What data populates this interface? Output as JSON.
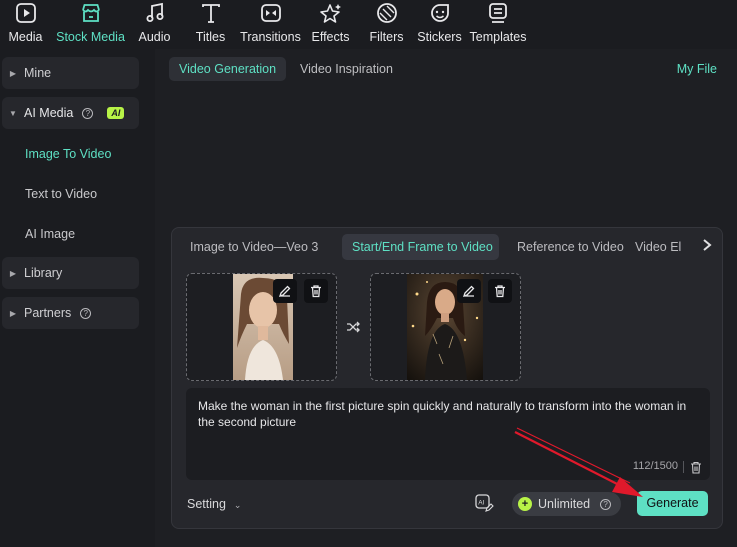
{
  "toolbar": {
    "items": [
      {
        "label": "Media",
        "icon": "media-icon"
      },
      {
        "label": "Stock Media",
        "icon": "stock-media-icon",
        "active": true
      },
      {
        "label": "Audio",
        "icon": "music-note-icon"
      },
      {
        "label": "Titles",
        "icon": "text-t-icon"
      },
      {
        "label": "Transitions",
        "icon": "transitions-icon"
      },
      {
        "label": "Effects",
        "icon": "effects-sparkle-icon"
      },
      {
        "label": "Filters",
        "icon": "filters-icon"
      },
      {
        "label": "Stickers",
        "icon": "stickers-icon"
      },
      {
        "label": "Templates",
        "icon": "templates-icon"
      }
    ]
  },
  "sidebar": {
    "mine": "Mine",
    "ai_media": "AI Media",
    "ai_badge": "AI",
    "image_to_video": "Image To Video",
    "text_to_video": "Text to Video",
    "ai_image": "AI Image",
    "library": "Library",
    "partners": "Partners"
  },
  "main": {
    "tab_video_generation": "Video Generation",
    "tab_video_inspiration": "Video Inspiration",
    "my_file": "My File"
  },
  "panel": {
    "subtabs": [
      "Image to Video—Veo 3",
      "Start/End Frame to Video",
      "Reference to Video",
      "Video El"
    ],
    "active_subtab": "Start/End Frame to Video",
    "prompt_text": "Make the woman in the first picture spin quickly and naturally to transform into the woman in the second picture",
    "char_count": "112/1500",
    "setting_label": "Setting",
    "unlimited_label": "Unlimited",
    "generate_label": "Generate"
  },
  "colors": {
    "accent": "#5ee0c4",
    "badge": "#b8f347",
    "background": "#1b1c20",
    "panel": "#26272c",
    "annotation_arrow": "#e0192b"
  }
}
